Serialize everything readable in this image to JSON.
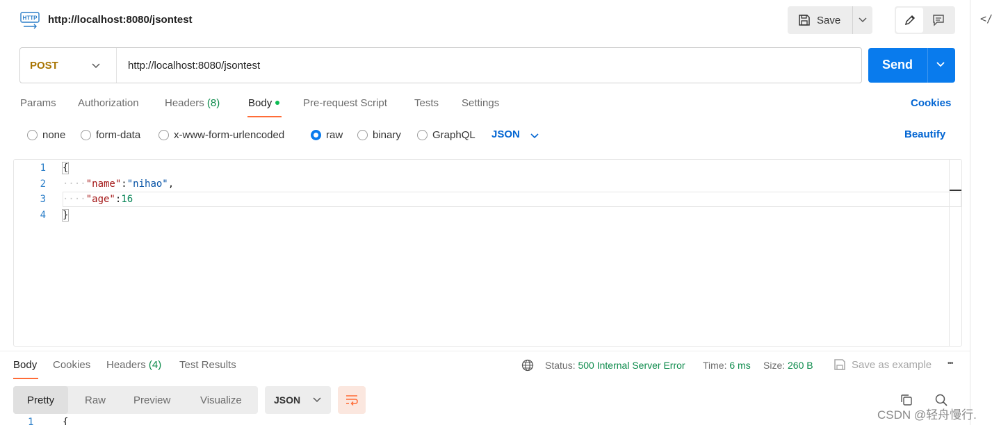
{
  "header": {
    "request_title": "http://localhost:8080/jsontest",
    "http_icon_text": "HTTP",
    "save_label": "Save",
    "code_label": "</"
  },
  "url_bar": {
    "method": "POST",
    "url": "http://localhost:8080/jsontest",
    "send_label": "Send"
  },
  "request_tabs": [
    {
      "label": "Params"
    },
    {
      "label": "Authorization"
    },
    {
      "label": "Headers",
      "count": "(8)"
    },
    {
      "label": "Body"
    },
    {
      "label": "Pre-request Script"
    },
    {
      "label": "Tests"
    },
    {
      "label": "Settings"
    }
  ],
  "cookies_label": "Cookies",
  "body_types": [
    {
      "label": "none",
      "selected": false
    },
    {
      "label": "form-data",
      "selected": false
    },
    {
      "label": "x-www-form-urlencoded",
      "selected": false
    },
    {
      "label": "raw",
      "selected": true
    },
    {
      "label": "binary",
      "selected": false
    },
    {
      "label": "GraphQL",
      "selected": false
    }
  ],
  "raw_format": "JSON",
  "beautify_label": "Beautify",
  "editor": {
    "line_numbers": [
      "1",
      "2",
      "3",
      "4"
    ],
    "lines": {
      "l1": "{",
      "l2_key": "\"name\"",
      "l2_colon": ":",
      "l2_value": "\"nihao\"",
      "l2_comma": ",",
      "l3_key": "\"age\"",
      "l3_colon": ":",
      "l3_value": "16",
      "l4": "}"
    }
  },
  "response": {
    "tabs": [
      {
        "label": "Body"
      },
      {
        "label": "Cookies"
      },
      {
        "label": "Headers",
        "count": "(4)"
      },
      {
        "label": "Test Results"
      }
    ],
    "status_label": "Status:",
    "status_value": "500 Internal Server Error",
    "time_label": "Time:",
    "time_value": "6 ms",
    "size_label": "Size:",
    "size_value": "260 B",
    "save_example_label": "Save as example",
    "more_label": "•••",
    "views": [
      "Pretty",
      "Raw",
      "Preview",
      "Visualize"
    ],
    "format": "JSON",
    "first_line_number": "1",
    "first_line_text": "{"
  },
  "watermark": "CSDN @轻舟慢行.",
  "colors": {
    "accent": "#ff6c37",
    "send": "#097bed",
    "status_ok_text": "#0b8a4a",
    "method": "#a77300"
  }
}
